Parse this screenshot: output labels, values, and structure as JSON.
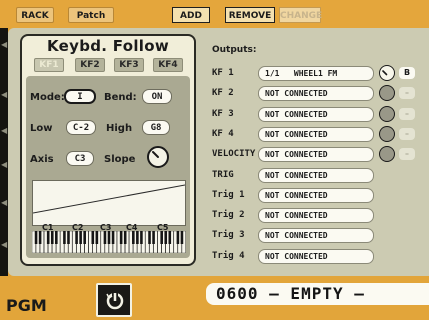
{
  "toolbar": {
    "rack_label": "RACK",
    "patch_label": "Patch",
    "add_label": "ADD",
    "remove_label": "REMOVE",
    "change_label": "CHANGE"
  },
  "kf": {
    "title": "Keybd. Follow",
    "tabs": [
      "KF1",
      "KF2",
      "KF3",
      "KF4"
    ],
    "active_tab": "KF1",
    "mode_label": "Mode:",
    "mode_value": "I",
    "bend_label": "Bend:",
    "bend_value": "ON",
    "low_label": "Low",
    "low_value": "C-2",
    "high_label": "High",
    "high_value": "G8",
    "axis_label": "Axis",
    "axis_value": "C3",
    "slope_label": "Slope",
    "key_labels": [
      "C1",
      "C2",
      "C3",
      "C4",
      "C5"
    ]
  },
  "outputs": {
    "title": "Outputs:",
    "rows": [
      {
        "label": "KF 1",
        "value": "1/1   WHEEL1 FM",
        "knob": true,
        "knob_active": true,
        "small": "B",
        "small_active": true
      },
      {
        "label": "KF 2",
        "value": "NOT CONNECTED",
        "knob": true,
        "knob_active": false,
        "small": "–",
        "small_active": false
      },
      {
        "label": "KF 3",
        "value": "NOT CONNECTED",
        "knob": true,
        "knob_active": false,
        "small": "–",
        "small_active": false
      },
      {
        "label": "KF 4",
        "value": "NOT CONNECTED",
        "knob": true,
        "knob_active": false,
        "small": "–",
        "small_active": false
      },
      {
        "label": "VELOCITY",
        "value": "NOT CONNECTED",
        "knob": true,
        "knob_active": false,
        "small": "–",
        "small_active": false
      },
      {
        "label": "TRIG",
        "value": "NOT CONNECTED",
        "knob": false
      },
      {
        "label": "Trig 1",
        "value": "NOT CONNECTED",
        "knob": false
      },
      {
        "label": "Trig 2",
        "value": "NOT CONNECTED",
        "knob": false
      },
      {
        "label": "Trig 3",
        "value": "NOT CONNECTED",
        "knob": false
      },
      {
        "label": "Trig 4",
        "value": "NOT CONNECTED",
        "knob": false
      }
    ]
  },
  "bottom": {
    "mode_label": "PGM",
    "program_name": "0600 — EMPTY —"
  },
  "colors": {
    "frame_orange": "#e2a53a",
    "panel_beige": "#cccbb2",
    "field_white": "#fbfaf2",
    "dark": "#1a1a16"
  }
}
